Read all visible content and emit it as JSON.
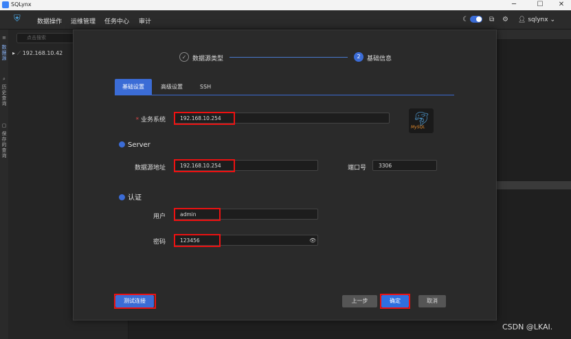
{
  "window": {
    "title": "SQLynx",
    "minimize": "─",
    "maximize": "☐",
    "close": "✕"
  },
  "menu": {
    "items": [
      "数据操作",
      "运维管理",
      "任务中心",
      "审计"
    ],
    "user": "sqlynx"
  },
  "left_rail": {
    "items": [
      "数据源",
      "历史查询",
      "保存的查询"
    ]
  },
  "sidebar": {
    "search_placeholder": "点击搜索",
    "tree_item": "192.168.10.42"
  },
  "dialog": {
    "steps": [
      {
        "num": "✓",
        "label": "数据源类型"
      },
      {
        "num": "2",
        "label": "基础信息"
      }
    ],
    "tabs": [
      "基础设置",
      "高级设置",
      "SSH"
    ],
    "business_system": {
      "label": "业务系统",
      "value": "192.168.10.254"
    },
    "server_section": "Server",
    "datasource_address": {
      "label": "数据源地址",
      "value": "192.168.10.254"
    },
    "port": {
      "label": "端口号",
      "value": "3306"
    },
    "auth_section": "认证",
    "user": {
      "label": "用户",
      "value": "admin"
    },
    "password": {
      "label": "密码",
      "value": "123456"
    },
    "mysql_logo": "MySQL",
    "buttons": {
      "test": "测试连接",
      "prev": "上一步",
      "ok": "确定",
      "cancel": "取消"
    }
  },
  "watermark": "CSDN @LKAI."
}
